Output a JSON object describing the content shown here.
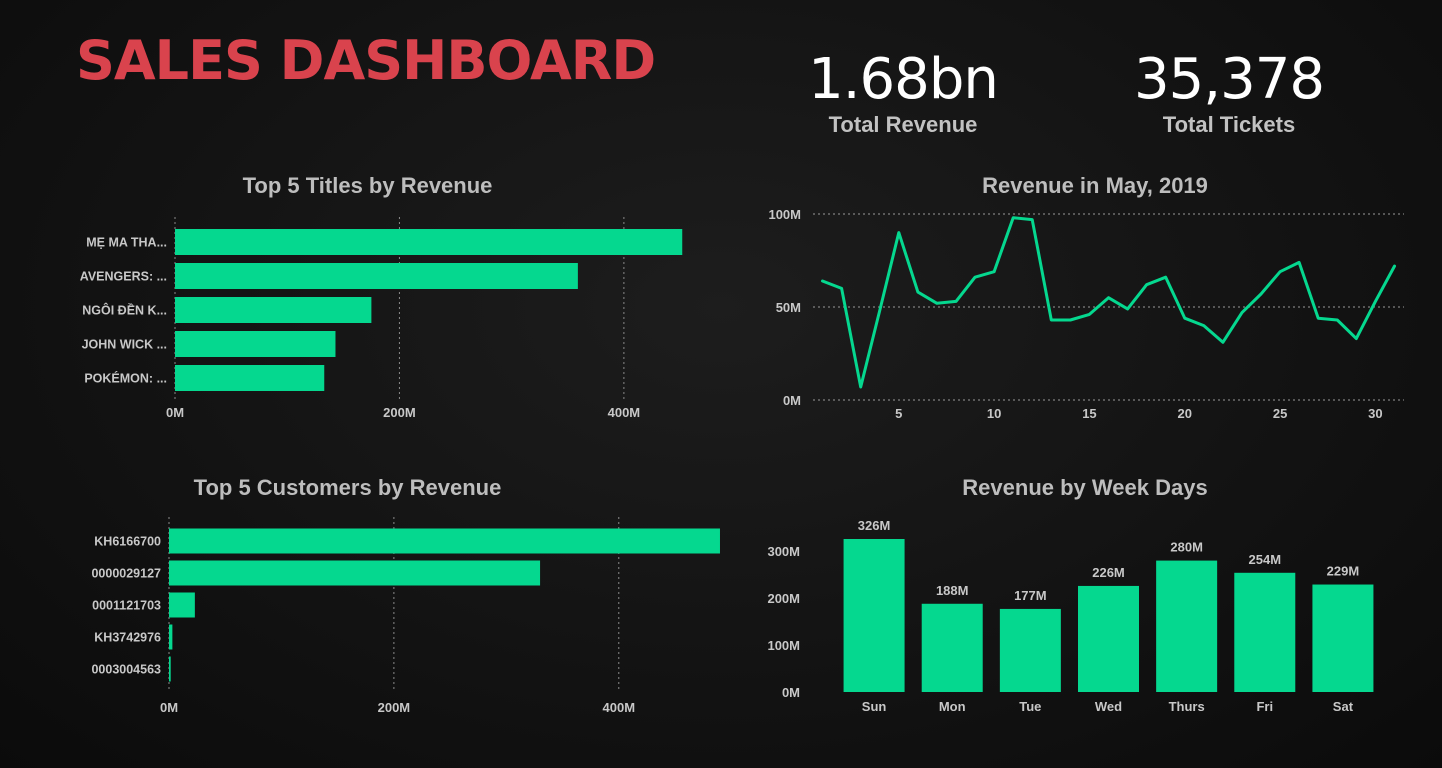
{
  "header": {
    "title": "SALES DASHBOARD",
    "kpis": [
      {
        "value": "1.68bn",
        "label": "Total Revenue"
      },
      {
        "value": "35,378",
        "label": "Total Tickets"
      }
    ]
  },
  "colors": {
    "accent": "#05d88f",
    "title": "#d9434d",
    "background": "#121212",
    "text": "#c8c8c8"
  },
  "chart_data": [
    {
      "id": "titles",
      "type": "bar",
      "orientation": "horizontal",
      "title": "Top 5 Titles by Revenue",
      "categories": [
        "MẸ MA THA...",
        "AVENGERS: ...",
        "NGÔI ĐỀN K...",
        "JOHN WICK ...",
        "POKÉMON: ..."
      ],
      "values": [
        452,
        359,
        175,
        143,
        133
      ],
      "unit": "M",
      "xlim": [
        0,
        450
      ],
      "ticks": [
        0,
        200,
        400
      ],
      "tick_labels": [
        "0M",
        "200M",
        "400M"
      ],
      "grid": true
    },
    {
      "id": "customers",
      "type": "bar",
      "orientation": "horizontal",
      "title": "Top 5 Customers by Revenue",
      "categories": [
        "KH6166700",
        "0000029127",
        "0001121703",
        "KH3742976",
        "0003004563"
      ],
      "values": [
        490,
        330,
        23,
        3,
        1.5
      ],
      "unit": "M",
      "xlim": [
        0,
        450
      ],
      "ticks": [
        0,
        200,
        400
      ],
      "tick_labels": [
        "0M",
        "200M",
        "400M"
      ],
      "grid": true
    },
    {
      "id": "daily",
      "type": "line",
      "title": "Revenue in May, 2019",
      "x": [
        1,
        2,
        3,
        4,
        5,
        6,
        7,
        8,
        9,
        10,
        11,
        12,
        13,
        14,
        15,
        16,
        17,
        18,
        19,
        20,
        21,
        22,
        23,
        24,
        25,
        26,
        27,
        28,
        29,
        30,
        31
      ],
      "y": [
        64,
        60,
        7,
        48,
        90,
        58,
        52,
        53,
        66,
        69,
        98,
        97,
        43,
        43,
        46,
        55,
        49,
        62,
        66,
        44,
        40,
        31,
        47,
        57,
        69,
        74,
        44,
        43,
        33,
        53,
        72
      ],
      "unit": "M",
      "xlim": [
        0.5,
        31.5
      ],
      "ylim": [
        0,
        100
      ],
      "xticks": [
        5,
        10,
        15,
        20,
        25,
        30
      ],
      "yticks": [
        0,
        50,
        100
      ],
      "ytick_labels": [
        "0M",
        "50M",
        "100M"
      ],
      "grid": true
    },
    {
      "id": "weekdays",
      "type": "bar",
      "title": "Revenue by Week Days",
      "categories": [
        "Sun",
        "Mon",
        "Tue",
        "Wed",
        "Thurs",
        "Fri",
        "Sat"
      ],
      "values": [
        326,
        188,
        177,
        226,
        280,
        254,
        229
      ],
      "data_labels": [
        "326M",
        "188M",
        "177M",
        "226M",
        "280M",
        "254M",
        "229M"
      ],
      "unit": "M",
      "ylim": [
        0,
        326
      ],
      "yticks": [
        0,
        100,
        200,
        300
      ],
      "ytick_labels": [
        "0M",
        "100M",
        "200M",
        "300M"
      ],
      "grid": false
    }
  ]
}
